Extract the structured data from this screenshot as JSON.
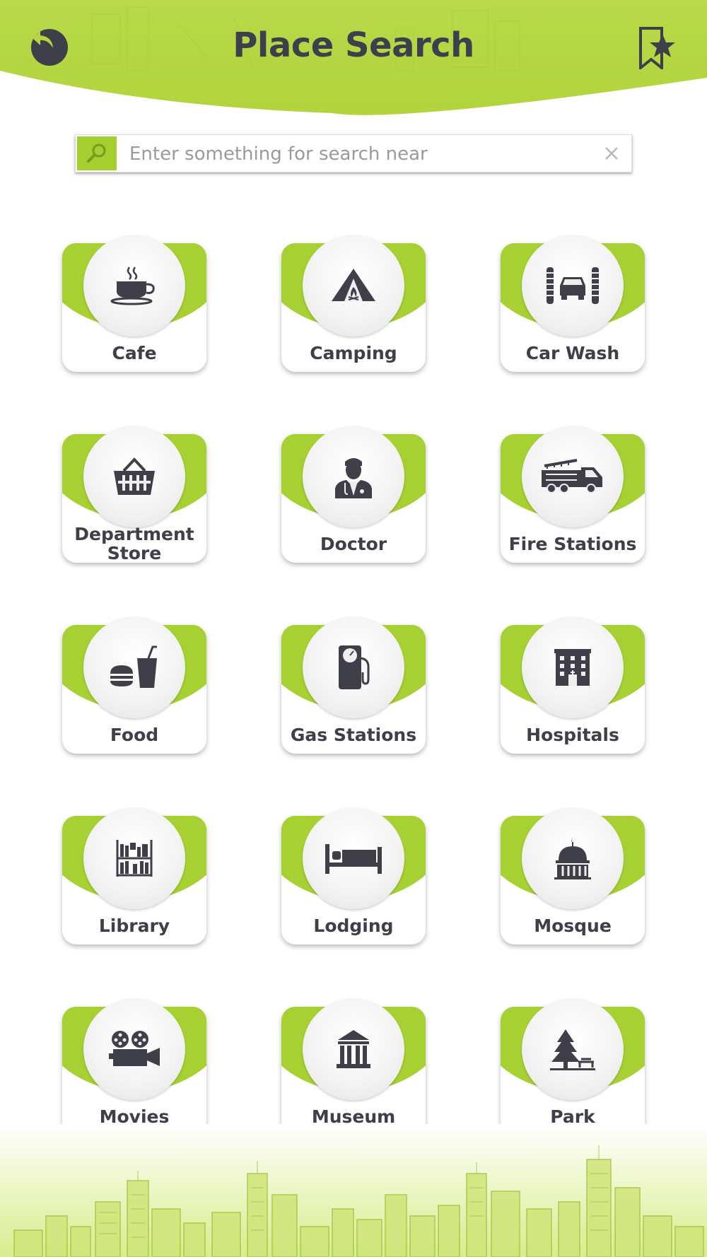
{
  "header": {
    "title": "Place Search",
    "back_icon": "back-arrow-icon",
    "bookmark_icon": "bookmark-star-icon",
    "accent_color": "#b5d540"
  },
  "search": {
    "placeholder": "Enter something for search near",
    "value": "",
    "search_icon": "search-icon",
    "clear_icon": "close-icon"
  },
  "categories": [
    {
      "label": "Cafe",
      "icon": "coffee-cup-icon"
    },
    {
      "label": "Camping",
      "icon": "tent-icon"
    },
    {
      "label": "Car Wash",
      "icon": "car-wash-icon"
    },
    {
      "label": "Department Store",
      "icon": "shopping-basket-icon"
    },
    {
      "label": "Doctor",
      "icon": "doctor-icon"
    },
    {
      "label": "Fire Stations",
      "icon": "fire-truck-icon"
    },
    {
      "label": "Food",
      "icon": "burger-drink-icon"
    },
    {
      "label": "Gas Stations",
      "icon": "fuel-pump-icon"
    },
    {
      "label": "Hospitals",
      "icon": "hospital-building-icon"
    },
    {
      "label": "Library",
      "icon": "bookshelf-icon"
    },
    {
      "label": "Lodging",
      "icon": "bed-icon"
    },
    {
      "label": "Mosque",
      "icon": "mosque-icon"
    },
    {
      "label": "Movies",
      "icon": "film-camera-icon"
    },
    {
      "label": "Museum",
      "icon": "museum-icon"
    },
    {
      "label": "Park",
      "icon": "tree-bench-icon"
    }
  ]
}
